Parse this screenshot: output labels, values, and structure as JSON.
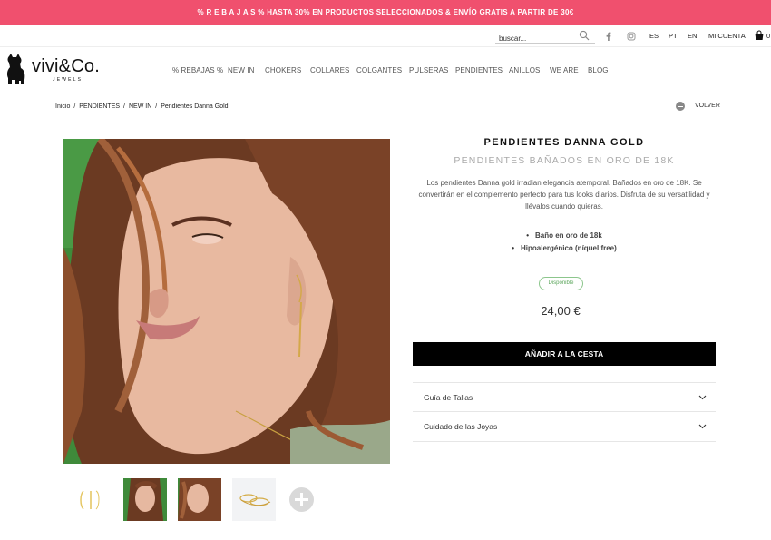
{
  "promo": {
    "text": "% R E B A J A S % HASTA 30% EN PRODUCTOS SELECCIONADOS & ENVÍO GRATIS A PARTIR DE 30€"
  },
  "utility": {
    "search_placeholder": "buscar...",
    "languages": [
      "ES",
      "PT",
      "EN"
    ],
    "account_label": "MI CUENTA",
    "cart_count": "0"
  },
  "logo": {
    "name": "vivi&Co.",
    "tagline": "JEWELS"
  },
  "nav": [
    "% REBAJAS %",
    "NEW IN",
    "CHOKERS",
    "COLLARES",
    "COLGANTES",
    "PULSERAS",
    "PENDIENTES",
    "ANILLOS",
    "WE ARE",
    "BLOG"
  ],
  "breadcrumb": [
    "Inicio",
    "/",
    "PENDIENTES",
    "/",
    "NEW IN",
    "/",
    "Pendientes Danna Gold"
  ],
  "back_label": "VOLVER",
  "product": {
    "title": "PENDIENTES DANNA GOLD",
    "subtitle": "PENDIENTES BAÑADOS EN ORO DE 18K",
    "description": "Los pendientes Danna gold irradian elegancia atemporal. Bañados en oro de 18K. Se convertirán en el complemento perfecto para tus looks diarios. Disfruta de su versatilidad y llévalos cuando quieras.",
    "features": [
      "Baño en oro de 18k",
      "Hipoalergénico (níquel free)"
    ],
    "availability": "Disponible",
    "price": "24,00 €",
    "add_to_cart": "AÑADIR A LA CESTA"
  },
  "accordions": [
    "Guía de Tallas",
    "Cuidado de las Joyas"
  ],
  "colors": {
    "promo": "#f0506e",
    "badge": "#8cc68c",
    "button": "#000000"
  }
}
